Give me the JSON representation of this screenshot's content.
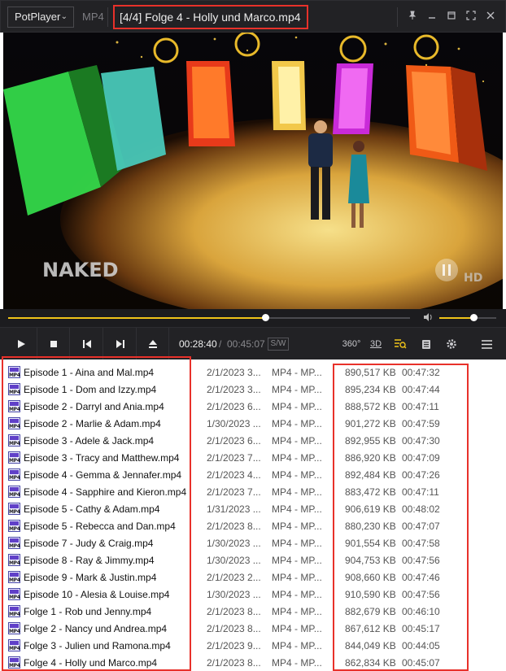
{
  "app": {
    "brand": "PotPlayer",
    "format_badge": "MP4",
    "window_title": "[4/4] Folge 4 - Holly und Marco.mp4"
  },
  "video": {
    "watermark": "NAKED",
    "hd_badge": "HD"
  },
  "seek": {
    "progress": 0.64
  },
  "volume": {
    "level": 0.6
  },
  "controls": {
    "time_current": "00:28:40",
    "time_separator": "/",
    "time_total": "00:45:07",
    "sw_label": "S/W",
    "vr_label": "360°",
    "threed_label": "3D"
  },
  "playlist": [
    {
      "name": "Episode 1 - Aina and Mal.mp4",
      "date": "2/1/2023 3...",
      "type": "MP4 - MP...",
      "size": "890,517 KB",
      "duration": "00:47:32"
    },
    {
      "name": "Episode 1 - Dom and Izzy.mp4",
      "date": "2/1/2023 3...",
      "type": "MP4 - MP...",
      "size": "895,234 KB",
      "duration": "00:47:44"
    },
    {
      "name": "Episode 2 - Darryl and Ania.mp4",
      "date": "2/1/2023 6...",
      "type": "MP4 - MP...",
      "size": "888,572 KB",
      "duration": "00:47:11"
    },
    {
      "name": "Episode 2 - Marlie & Adam.mp4",
      "date": "1/30/2023 ...",
      "type": "MP4 - MP...",
      "size": "901,272 KB",
      "duration": "00:47:59"
    },
    {
      "name": "Episode 3 - Adele & Jack.mp4",
      "date": "2/1/2023 6...",
      "type": "MP4 - MP...",
      "size": "892,955 KB",
      "duration": "00:47:30"
    },
    {
      "name": "Episode 3 - Tracy and Matthew.mp4",
      "date": "2/1/2023 7...",
      "type": "MP4 - MP...",
      "size": "886,920 KB",
      "duration": "00:47:09"
    },
    {
      "name": "Episode 4 - Gemma & Jennafer.mp4",
      "date": "2/1/2023 4...",
      "type": "MP4 - MP...",
      "size": "892,484 KB",
      "duration": "00:47:26"
    },
    {
      "name": "Episode 4 - Sapphire and Kieron.mp4",
      "date": "2/1/2023 7...",
      "type": "MP4 - MP...",
      "size": "883,472 KB",
      "duration": "00:47:11"
    },
    {
      "name": "Episode 5 - Cathy & Adam.mp4",
      "date": "1/31/2023 ...",
      "type": "MP4 - MP...",
      "size": "906,619 KB",
      "duration": "00:48:02"
    },
    {
      "name": "Episode 5 - Rebecca and Dan.mp4",
      "date": "2/1/2023 8...",
      "type": "MP4 - MP...",
      "size": "880,230 KB",
      "duration": "00:47:07"
    },
    {
      "name": "Episode 7 - Judy & Craig.mp4",
      "date": "1/30/2023 ...",
      "type": "MP4 - MP...",
      "size": "901,554 KB",
      "duration": "00:47:58"
    },
    {
      "name": "Episode 8 - Ray & Jimmy.mp4",
      "date": "1/30/2023 ...",
      "type": "MP4 - MP...",
      "size": "904,753 KB",
      "duration": "00:47:56"
    },
    {
      "name": "Episode 9 - Mark & Justin.mp4",
      "date": "2/1/2023 2...",
      "type": "MP4 - MP...",
      "size": "908,660 KB",
      "duration": "00:47:46"
    },
    {
      "name": "Episode 10 - Alesia & Louise.mp4",
      "date": "1/30/2023 ...",
      "type": "MP4 - MP...",
      "size": "910,590 KB",
      "duration": "00:47:56"
    },
    {
      "name": "Folge 1 - Rob und Jenny.mp4",
      "date": "2/1/2023 8...",
      "type": "MP4 - MP...",
      "size": "882,679 KB",
      "duration": "00:46:10"
    },
    {
      "name": "Folge 2 - Nancy und Andrea.mp4",
      "date": "2/1/2023 8...",
      "type": "MP4 - MP...",
      "size": "867,612 KB",
      "duration": "00:45:17"
    },
    {
      "name": "Folge 3 - Julien und Ramona.mp4",
      "date": "2/1/2023 9...",
      "type": "MP4 - MP...",
      "size": "844,049 KB",
      "duration": "00:44:05"
    },
    {
      "name": "Folge 4 - Holly und Marco.mp4",
      "date": "2/1/2023 8...",
      "type": "MP4 - MP...",
      "size": "862,834 KB",
      "duration": "00:45:07"
    }
  ],
  "icons": {
    "file_icon_label": "MP4"
  },
  "colors": {
    "highlight": "#e8312a",
    "accent": "#f0c419",
    "chrome": "#222225"
  }
}
